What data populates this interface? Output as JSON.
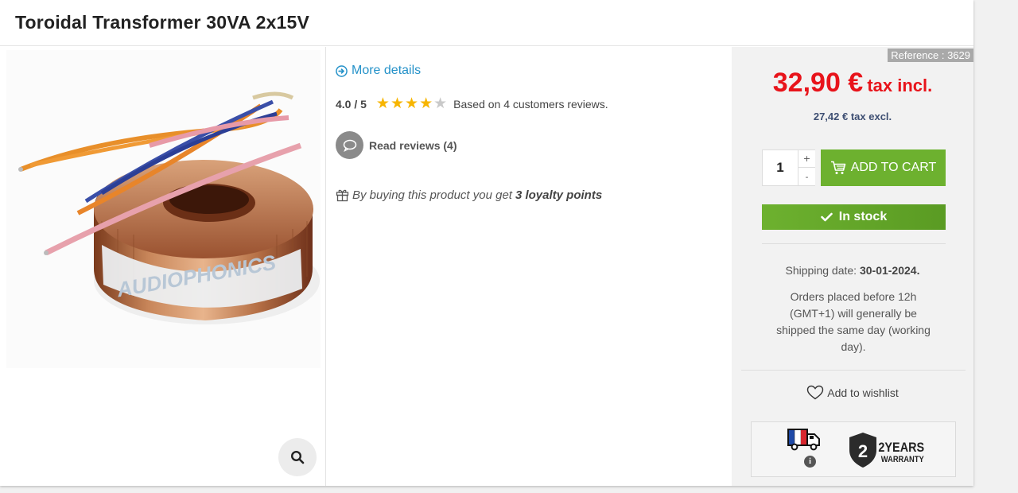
{
  "product": {
    "title": "Toroidal Transformer 30VA 2x15V"
  },
  "image": {
    "brand_text": "AUDIOPHONICS",
    "zoom_icon": "search-icon"
  },
  "details": {
    "more_details": "More details",
    "rating_value": "4.0 / 5",
    "rating_stars": 4,
    "rating_max": 5,
    "based_on": "Based on 4 customers reviews.",
    "read_reviews": "Read reviews (4)",
    "loyalty_prefix": "By buying this product you get",
    "loyalty_points": "3 loyalty points"
  },
  "buy": {
    "reference": "Reference : 3629",
    "price": "32,90 €",
    "tax_incl": "tax incl.",
    "price_excl": "27,42 € tax excl.",
    "quantity": "1",
    "qty_up": "+",
    "qty_down": "-",
    "add_to_cart": "ADD TO CART",
    "stock": "In stock",
    "ship_label": "Shipping date:",
    "ship_date": "30-01-2024.",
    "ship_note": "Orders placed before 12h (GMT+1) will generally be shipped the same day (working day).",
    "wishlist": "Add to wishlist",
    "warranty_years": "2YEARS",
    "warranty_label": "WARRANTY",
    "warranty_number": "2"
  },
  "colors": {
    "price_red": "#e8141b",
    "cart_green": "#6db12f",
    "link_blue": "#2592c9",
    "star_gold": "#f7b500"
  }
}
